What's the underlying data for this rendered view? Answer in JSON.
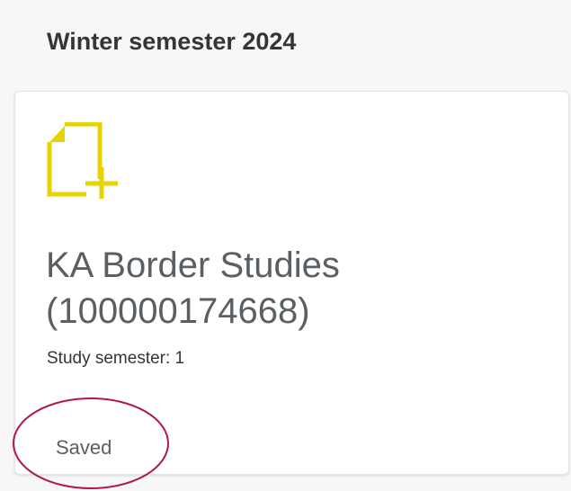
{
  "section": {
    "title": "Winter semester 2024"
  },
  "card": {
    "icon": "document-add-icon",
    "title_line1": "KA Border Studies",
    "title_line2": "(100000174668)",
    "subtitle": "Study semester: 1",
    "status": "Saved"
  },
  "colors": {
    "icon_accent": "#e6d400",
    "annotation": "#b0184a",
    "title_text": "#5a5f63",
    "heading_text": "#32363a"
  }
}
